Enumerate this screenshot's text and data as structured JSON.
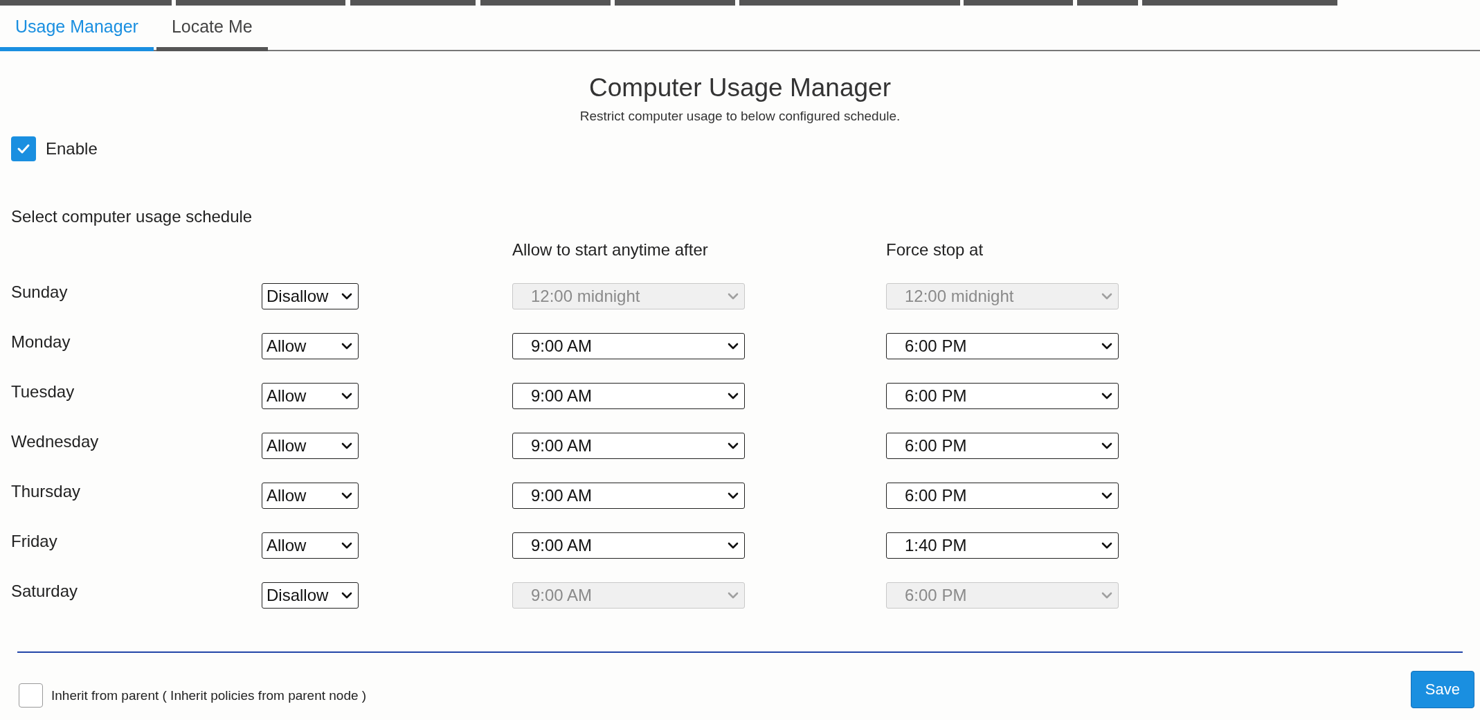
{
  "tabs": [
    {
      "label": "Usage Manager",
      "selected": true
    },
    {
      "label": "Locate Me",
      "selected": false
    }
  ],
  "title": "Computer Usage Manager",
  "subtitle": "Restrict computer usage to below configured schedule.",
  "enable": {
    "label": "Enable",
    "checked": true
  },
  "schedule": {
    "heading": "Select computer usage schedule",
    "columns": [
      "Allow to start anytime after",
      "Force stop at"
    ],
    "rows": [
      {
        "day": "Sunday",
        "mode": "Disallow",
        "start": "12:00 midnight",
        "stop": "12:00 midnight",
        "disabled": true
      },
      {
        "day": "Monday",
        "mode": "Allow",
        "start": "9:00 AM",
        "stop": "6:00 PM",
        "disabled": false
      },
      {
        "day": "Tuesday",
        "mode": "Allow",
        "start": "9:00 AM",
        "stop": "6:00 PM",
        "disabled": false
      },
      {
        "day": "Wednesday",
        "mode": "Allow",
        "start": "9:00 AM",
        "stop": "6:00 PM",
        "disabled": false
      },
      {
        "day": "Thursday",
        "mode": "Allow",
        "start": "9:00 AM",
        "stop": "6:00 PM",
        "disabled": false
      },
      {
        "day": "Friday",
        "mode": "Allow",
        "start": "9:00 AM",
        "stop": "1:40 PM",
        "disabled": false
      },
      {
        "day": "Saturday",
        "mode": "Disallow",
        "start": "9:00 AM",
        "stop": "6:00 PM",
        "disabled": true
      }
    ]
  },
  "inherit": {
    "label": "Inherit from parent ( Inherit policies from parent node )",
    "checked": false
  },
  "save_button": "Save"
}
